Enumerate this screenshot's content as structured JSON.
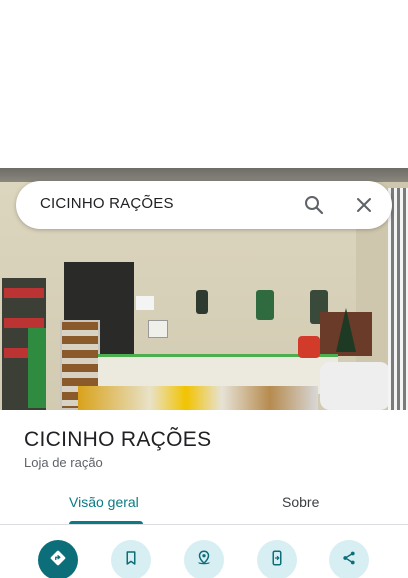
{
  "search": {
    "query": "CICINHO RAÇÕES",
    "search_icon": "search-icon",
    "close_icon": "close-icon"
  },
  "place": {
    "name": "CICINHO RAÇÕES",
    "category": "Loja de ração"
  },
  "tabs": [
    {
      "label": "Visão geral",
      "selected": true
    },
    {
      "label": "Sobre",
      "selected": false
    }
  ],
  "actions": [
    {
      "icon": "directions-icon"
    },
    {
      "icon": "bookmark-icon"
    },
    {
      "icon": "nearby-icon"
    },
    {
      "icon": "send-to-phone-icon"
    },
    {
      "icon": "share-icon"
    }
  ],
  "colors": {
    "accent": "#0b7a85",
    "action_bg": "#d7eef2",
    "primary_action_bg": "#0b6e79"
  }
}
